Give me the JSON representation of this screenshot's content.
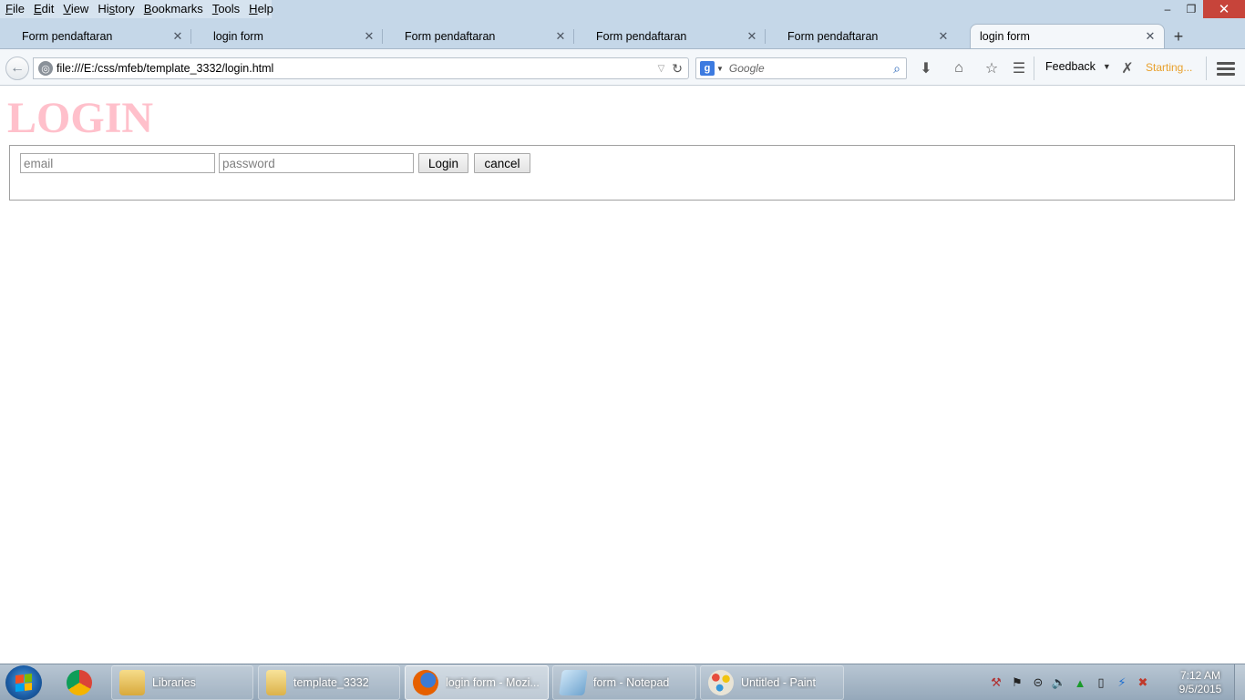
{
  "menubar": {
    "items": [
      {
        "label": "File",
        "accesskey_index": 0
      },
      {
        "label": "Edit",
        "accesskey_index": 0
      },
      {
        "label": "View",
        "accesskey_index": 0
      },
      {
        "label": "History",
        "accesskey_index": 2
      },
      {
        "label": "Bookmarks",
        "accesskey_index": 0
      },
      {
        "label": "Tools",
        "accesskey_index": 0
      },
      {
        "label": "Help",
        "accesskey_index": 0
      }
    ]
  },
  "window_controls": {
    "minimize": "–",
    "restore": "❐",
    "close": "✕"
  },
  "tabs": [
    {
      "label": "Form pendaftaran",
      "active": false
    },
    {
      "label": "login form",
      "active": false
    },
    {
      "label": "Form pendaftaran",
      "active": false
    },
    {
      "label": "Form pendaftaran",
      "active": false
    },
    {
      "label": "Form pendaftaran",
      "active": false
    },
    {
      "label": "login form",
      "active": true
    }
  ],
  "tab_close_glyph": "✕",
  "new_tab_glyph": "+",
  "navbar": {
    "url": "file:///E:/css/mfeb/template_3332/login.html",
    "search_placeholder": "Google",
    "feedback_label": "Feedback",
    "status_text": "Starting..."
  },
  "icons": {
    "back": "back-arrow-icon",
    "site_identity": "globe-icon",
    "reload": "reload-icon",
    "search_engine": "google-icon",
    "search": "magnifier-icon",
    "downloads": "download-arrow-icon",
    "home": "home-icon",
    "bookmark": "star-icon",
    "reading_list": "bookmarks-list-icon",
    "addon": "addon-x-icon",
    "menu": "hamburger-menu-icon"
  },
  "page": {
    "heading": "LOGIN",
    "heading_color": "#ffc0cb",
    "email_placeholder": "email",
    "password_placeholder": "password",
    "login_button": "Login",
    "cancel_button": "cancel"
  },
  "taskbar": {
    "items": [
      {
        "label": "",
        "icon": "chrome-icon",
        "pinned": true
      },
      {
        "label": "Libraries",
        "icon": "libraries-folder-icon"
      },
      {
        "label": "template_3332",
        "icon": "folder-icon"
      },
      {
        "label": "login form - Mozi...",
        "icon": "firefox-icon",
        "active": true
      },
      {
        "label": "form - Notepad",
        "icon": "notepad-icon"
      },
      {
        "label": "Untitled - Paint",
        "icon": "paint-icon"
      }
    ],
    "tray_icons": [
      "network-tool-icon",
      "action-center-flag-icon",
      "connection-icon",
      "volume-icon",
      "upload-arrow-icon",
      "battery-icon",
      "power-bolt-icon",
      "network-error-icon"
    ],
    "clock_time": "7:12 AM",
    "clock_date": "9/5/2015"
  },
  "colors": {
    "accent_close": "#c7443a",
    "status_orange": "#e8a02c",
    "window_frame": "#c5d7e8"
  }
}
